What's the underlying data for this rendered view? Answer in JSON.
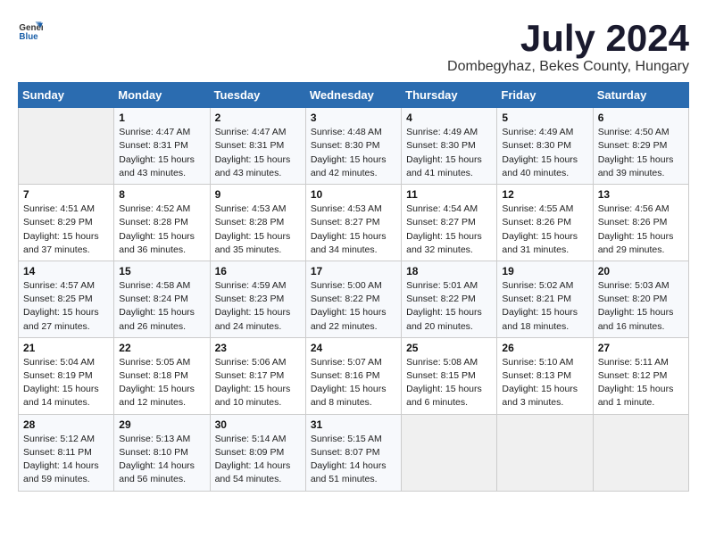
{
  "header": {
    "logo_general": "General",
    "logo_blue": "Blue",
    "month_title": "July 2024",
    "location": "Dombegyhaz, Bekes County, Hungary"
  },
  "calendar": {
    "headers": [
      "Sunday",
      "Monday",
      "Tuesday",
      "Wednesday",
      "Thursday",
      "Friday",
      "Saturday"
    ],
    "weeks": [
      [
        {
          "day": "",
          "info": ""
        },
        {
          "day": "1",
          "info": "Sunrise: 4:47 AM\nSunset: 8:31 PM\nDaylight: 15 hours\nand 43 minutes."
        },
        {
          "day": "2",
          "info": "Sunrise: 4:47 AM\nSunset: 8:31 PM\nDaylight: 15 hours\nand 43 minutes."
        },
        {
          "day": "3",
          "info": "Sunrise: 4:48 AM\nSunset: 8:30 PM\nDaylight: 15 hours\nand 42 minutes."
        },
        {
          "day": "4",
          "info": "Sunrise: 4:49 AM\nSunset: 8:30 PM\nDaylight: 15 hours\nand 41 minutes."
        },
        {
          "day": "5",
          "info": "Sunrise: 4:49 AM\nSunset: 8:30 PM\nDaylight: 15 hours\nand 40 minutes."
        },
        {
          "day": "6",
          "info": "Sunrise: 4:50 AM\nSunset: 8:29 PM\nDaylight: 15 hours\nand 39 minutes."
        }
      ],
      [
        {
          "day": "7",
          "info": "Sunrise: 4:51 AM\nSunset: 8:29 PM\nDaylight: 15 hours\nand 37 minutes."
        },
        {
          "day": "8",
          "info": "Sunrise: 4:52 AM\nSunset: 8:28 PM\nDaylight: 15 hours\nand 36 minutes."
        },
        {
          "day": "9",
          "info": "Sunrise: 4:53 AM\nSunset: 8:28 PM\nDaylight: 15 hours\nand 35 minutes."
        },
        {
          "day": "10",
          "info": "Sunrise: 4:53 AM\nSunset: 8:27 PM\nDaylight: 15 hours\nand 34 minutes."
        },
        {
          "day": "11",
          "info": "Sunrise: 4:54 AM\nSunset: 8:27 PM\nDaylight: 15 hours\nand 32 minutes."
        },
        {
          "day": "12",
          "info": "Sunrise: 4:55 AM\nSunset: 8:26 PM\nDaylight: 15 hours\nand 31 minutes."
        },
        {
          "day": "13",
          "info": "Sunrise: 4:56 AM\nSunset: 8:26 PM\nDaylight: 15 hours\nand 29 minutes."
        }
      ],
      [
        {
          "day": "14",
          "info": "Sunrise: 4:57 AM\nSunset: 8:25 PM\nDaylight: 15 hours\nand 27 minutes."
        },
        {
          "day": "15",
          "info": "Sunrise: 4:58 AM\nSunset: 8:24 PM\nDaylight: 15 hours\nand 26 minutes."
        },
        {
          "day": "16",
          "info": "Sunrise: 4:59 AM\nSunset: 8:23 PM\nDaylight: 15 hours\nand 24 minutes."
        },
        {
          "day": "17",
          "info": "Sunrise: 5:00 AM\nSunset: 8:22 PM\nDaylight: 15 hours\nand 22 minutes."
        },
        {
          "day": "18",
          "info": "Sunrise: 5:01 AM\nSunset: 8:22 PM\nDaylight: 15 hours\nand 20 minutes."
        },
        {
          "day": "19",
          "info": "Sunrise: 5:02 AM\nSunset: 8:21 PM\nDaylight: 15 hours\nand 18 minutes."
        },
        {
          "day": "20",
          "info": "Sunrise: 5:03 AM\nSunset: 8:20 PM\nDaylight: 15 hours\nand 16 minutes."
        }
      ],
      [
        {
          "day": "21",
          "info": "Sunrise: 5:04 AM\nSunset: 8:19 PM\nDaylight: 15 hours\nand 14 minutes."
        },
        {
          "day": "22",
          "info": "Sunrise: 5:05 AM\nSunset: 8:18 PM\nDaylight: 15 hours\nand 12 minutes."
        },
        {
          "day": "23",
          "info": "Sunrise: 5:06 AM\nSunset: 8:17 PM\nDaylight: 15 hours\nand 10 minutes."
        },
        {
          "day": "24",
          "info": "Sunrise: 5:07 AM\nSunset: 8:16 PM\nDaylight: 15 hours\nand 8 minutes."
        },
        {
          "day": "25",
          "info": "Sunrise: 5:08 AM\nSunset: 8:15 PM\nDaylight: 15 hours\nand 6 minutes."
        },
        {
          "day": "26",
          "info": "Sunrise: 5:10 AM\nSunset: 8:13 PM\nDaylight: 15 hours\nand 3 minutes."
        },
        {
          "day": "27",
          "info": "Sunrise: 5:11 AM\nSunset: 8:12 PM\nDaylight: 15 hours\nand 1 minute."
        }
      ],
      [
        {
          "day": "28",
          "info": "Sunrise: 5:12 AM\nSunset: 8:11 PM\nDaylight: 14 hours\nand 59 minutes."
        },
        {
          "day": "29",
          "info": "Sunrise: 5:13 AM\nSunset: 8:10 PM\nDaylight: 14 hours\nand 56 minutes."
        },
        {
          "day": "30",
          "info": "Sunrise: 5:14 AM\nSunset: 8:09 PM\nDaylight: 14 hours\nand 54 minutes."
        },
        {
          "day": "31",
          "info": "Sunrise: 5:15 AM\nSunset: 8:07 PM\nDaylight: 14 hours\nand 51 minutes."
        },
        {
          "day": "",
          "info": ""
        },
        {
          "day": "",
          "info": ""
        },
        {
          "day": "",
          "info": ""
        }
      ]
    ]
  }
}
